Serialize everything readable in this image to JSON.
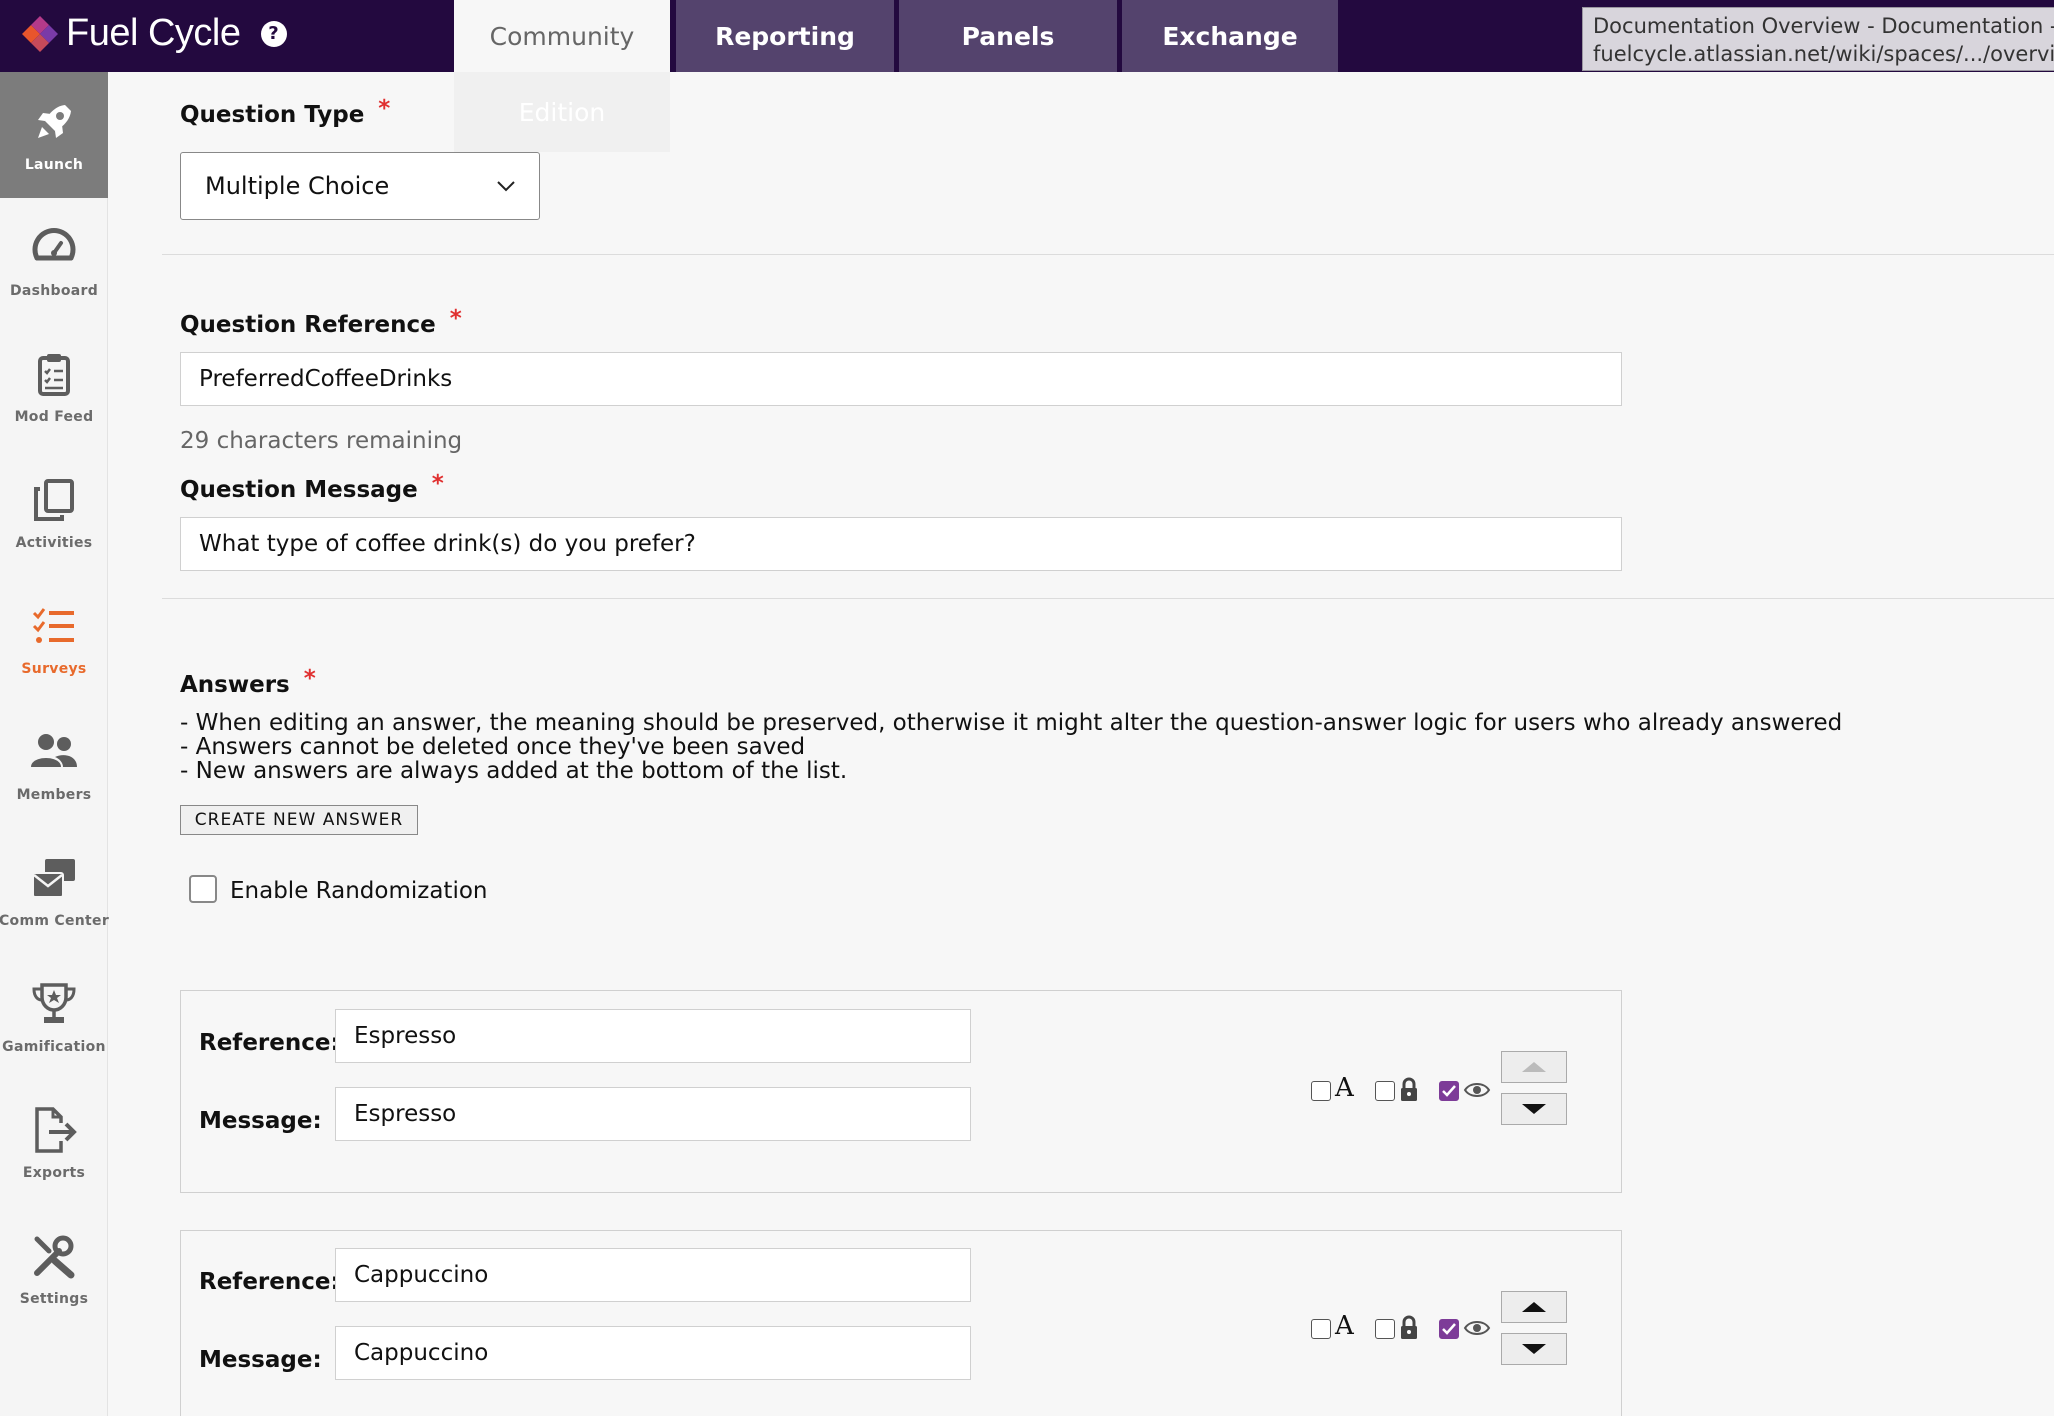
{
  "brand": {
    "name": "Fuel Cycle",
    "help_icon": "question-circle-icon"
  },
  "tabs": [
    {
      "label": "Community",
      "active": true
    },
    {
      "label": "Reporting"
    },
    {
      "label": "Panels"
    },
    {
      "label": "Exchange"
    }
  ],
  "tab_overlay": "Edition",
  "tooltip": {
    "line1": "Documentation Overview - Documentation -",
    "line2": "fuelcycle.atlassian.net/wiki/spaces/.../overview"
  },
  "sidebar": {
    "items": [
      {
        "label": "Launch",
        "icon": "rocket-icon"
      },
      {
        "label": "Dashboard",
        "icon": "gauge-icon"
      },
      {
        "label": "Mod Feed",
        "icon": "clipboard-icon"
      },
      {
        "label": "Activities",
        "icon": "copy-icon"
      },
      {
        "label": "Surveys",
        "icon": "checklist-icon"
      },
      {
        "label": "Members",
        "icon": "users-icon"
      },
      {
        "label": "Comm Center",
        "icon": "mail-icon"
      },
      {
        "label": "Gamification",
        "icon": "trophy-icon"
      },
      {
        "label": "Exports",
        "icon": "export-icon"
      },
      {
        "label": "Settings",
        "icon": "tools-icon"
      }
    ]
  },
  "form": {
    "question_type": {
      "label": "Question Type",
      "value": "Multiple Choice"
    },
    "question_reference": {
      "label": "Question Reference",
      "value": "PreferredCoffeeDrinks",
      "remaining": "29 characters remaining"
    },
    "question_message": {
      "label": "Question Message",
      "value": "What type of coffee drink(s) do you prefer?"
    },
    "answers": {
      "label": "Answers",
      "notes": [
        "- When editing an answer, the meaning should be preserved, otherwise it might alter the question-answer logic for users who already answered",
        "- Answers cannot be deleted once they've been saved",
        "- New answers are always added at the bottom of the list."
      ],
      "create_button": "CREATE NEW ANSWER",
      "randomization_label": "Enable Randomization",
      "reference_label": "Reference:",
      "message_label": "Message:",
      "items": [
        {
          "reference": "Espresso",
          "message": "Espresso"
        },
        {
          "reference": "Cappuccino",
          "message": "Cappuccino"
        }
      ],
      "text_flag_glyph": "A"
    }
  },
  "colors": {
    "topbar": "#23093f",
    "tab": "#54436d",
    "accent_orange": "#e86a2c",
    "check_purple": "#7d3c98"
  }
}
